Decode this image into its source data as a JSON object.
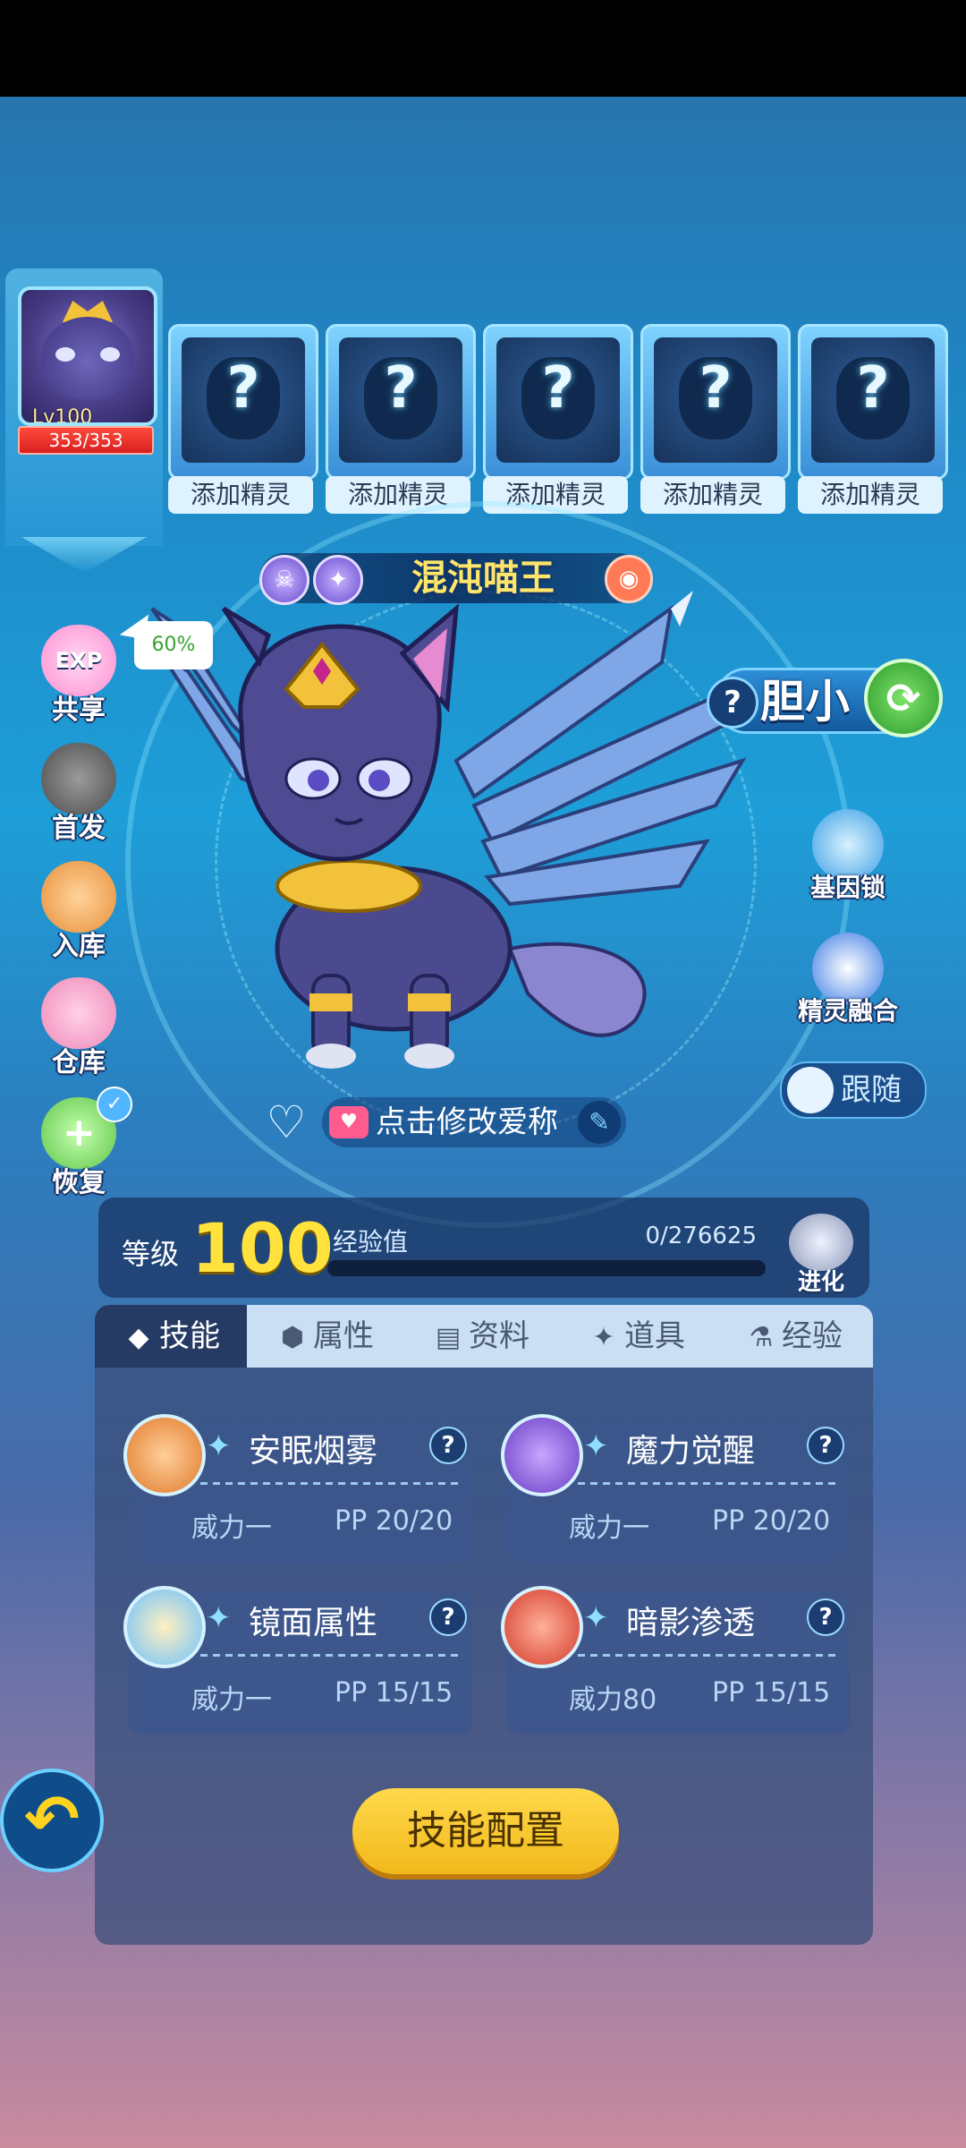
{
  "party": {
    "active": {
      "level": "Lv100",
      "hp": "353/353"
    },
    "empty_slot_label": "添加精灵",
    "empty_slots": [
      "添加精灵",
      "添加精灵",
      "添加精灵",
      "添加精灵",
      "添加精灵"
    ]
  },
  "pet": {
    "name": "混沌喵王",
    "nickname_hint": "点击修改爱称",
    "personality": "胆小"
  },
  "left_menu": {
    "exp_share": "EXP",
    "share": "共享",
    "share_percent": "60%",
    "first": "首发",
    "storage_in": "入库",
    "warehouse": "仓库",
    "recover": "恢复"
  },
  "right_menu": {
    "gene_lock": "基因锁",
    "fusion": "精灵融合",
    "follow": "跟随"
  },
  "level": {
    "label": "等级",
    "value": "100",
    "exp_label": "经验值",
    "exp_value": "0/276625",
    "exp_fraction": 0.0,
    "evolve": "进化"
  },
  "tabs": [
    "技能",
    "属性",
    "资料",
    "道具",
    "经验"
  ],
  "skills": [
    {
      "name": "安眠烟雾",
      "power": "威力一",
      "pp": "PP 20/20"
    },
    {
      "name": "魔力觉醒",
      "power": "威力一",
      "pp": "PP 20/20"
    },
    {
      "name": "镜面属性",
      "power": "威力一",
      "pp": "PP 15/15"
    },
    {
      "name": "暗影渗透",
      "power": "威力80",
      "pp": "PP 15/15"
    }
  ],
  "config_button": "技能配置",
  "colors": {
    "accent_yellow": "#ffe23c",
    "hp_red": "#d82020",
    "panel": "#253b64"
  }
}
